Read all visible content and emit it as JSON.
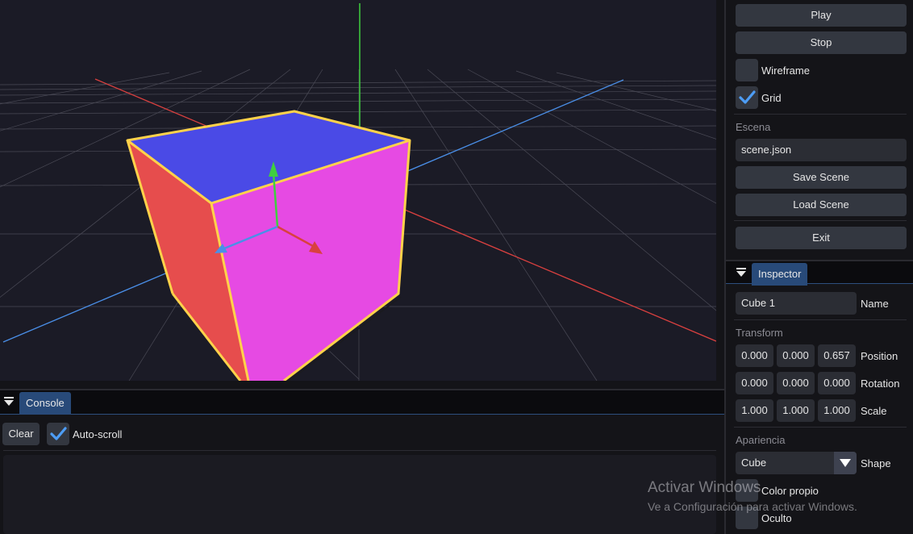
{
  "viewport": {
    "colors": {
      "background": "#1b1b26",
      "grid": "#5a5a66",
      "axis_x": "#d9403f",
      "axis_y": "#3fcf3f",
      "axis_z": "#4a8fe8",
      "cube_top": "#4a4ae6",
      "cube_left": "#e64d4d",
      "cube_front": "#e64ae3",
      "selection_outline": "#ffd24a"
    }
  },
  "toolbar": {
    "play_label": "Play",
    "stop_label": "Stop",
    "wireframe_label": "Wireframe",
    "wireframe_checked": false,
    "grid_label": "Grid",
    "grid_checked": true
  },
  "scene": {
    "section_label": "Escena",
    "filename": "scene.json",
    "save_label": "Save Scene",
    "load_label": "Load Scene",
    "exit_label": "Exit"
  },
  "inspector": {
    "tab_label": "Inspector",
    "name_value": "Cube 1",
    "name_label": "Name",
    "transform_label": "Transform",
    "position": [
      "0.000",
      "0.000",
      "0.657"
    ],
    "position_label": "Position",
    "rotation": [
      "0.000",
      "0.000",
      "0.000"
    ],
    "rotation_label": "Rotation",
    "scale": [
      "1.000",
      "1.000",
      "1.000"
    ],
    "scale_label": "Scale",
    "appearance_label": "Apariencia",
    "shape_value": "Cube",
    "shape_label": "Shape",
    "color_label": "Color propio",
    "hidden_label": "Oculto"
  },
  "console": {
    "tab_label": "Console",
    "clear_label": "Clear",
    "autoscroll_label": "Auto-scroll",
    "autoscroll_checked": true
  },
  "watermark": {
    "line1": "Activar Windows",
    "line2": "Ve a Configuración para activar Windows."
  },
  "theme": {
    "accent": "#284a79",
    "check": "#4d9df5"
  }
}
